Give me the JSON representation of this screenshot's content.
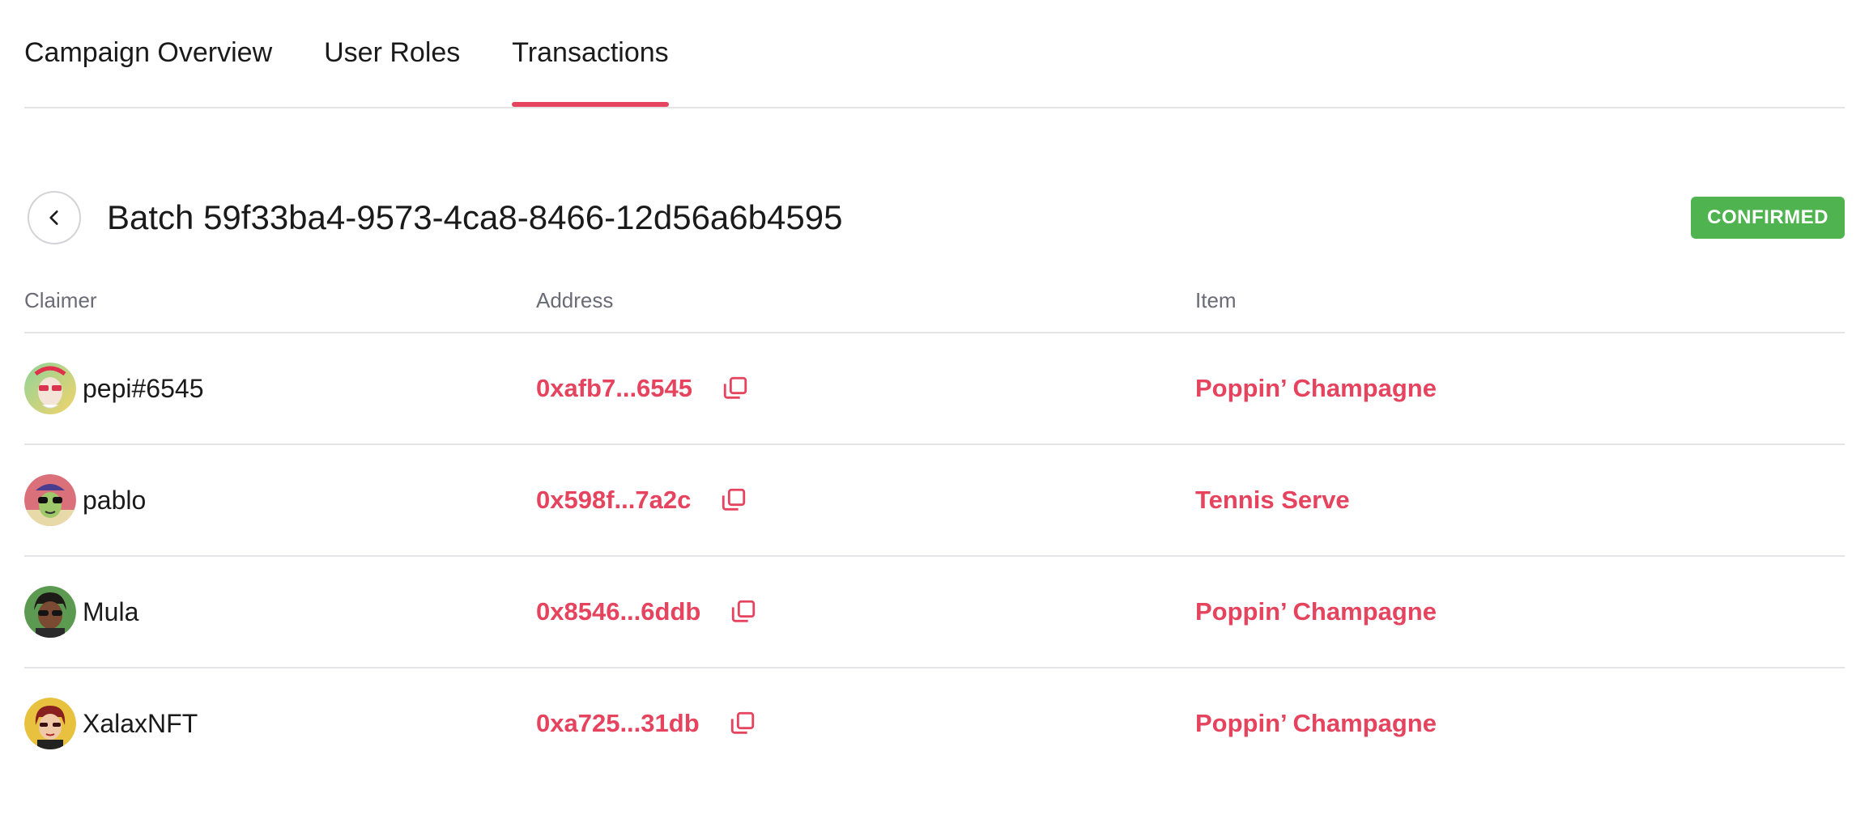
{
  "colors": {
    "accent": "#e5435e",
    "success": "#4fb34f",
    "divider": "#e4e4e7",
    "muted": "#6b6b75"
  },
  "tabs": [
    {
      "label": "Campaign Overview",
      "active": false
    },
    {
      "label": "User Roles",
      "active": false
    },
    {
      "label": "Transactions",
      "active": true
    }
  ],
  "header": {
    "back_icon": "chevron-left-icon",
    "title": "Batch 59f33ba4-9573-4ca8-8466-12d56a6b4595",
    "status": "CONFIRMED"
  },
  "table": {
    "columns": [
      "Claimer",
      "Address",
      "Item"
    ],
    "copy_icon": "copy-icon",
    "rows": [
      {
        "claimer": "pepi#6545",
        "avatar_icon": "pepi-avatar-icon",
        "address": "0xafb7...6545",
        "item": "Poppin’ Champagne"
      },
      {
        "claimer": "pablo",
        "avatar_icon": "pablo-avatar-icon",
        "address": "0x598f...7a2c",
        "item": "Tennis Serve"
      },
      {
        "claimer": "Mula",
        "avatar_icon": "mula-avatar-icon",
        "address": "0x8546...6ddb",
        "item": "Poppin’ Champagne"
      },
      {
        "claimer": "XalaxNFT",
        "avatar_icon": "xalax-avatar-icon",
        "address": "0xa725...31db",
        "item": "Poppin’ Champagne"
      }
    ]
  }
}
